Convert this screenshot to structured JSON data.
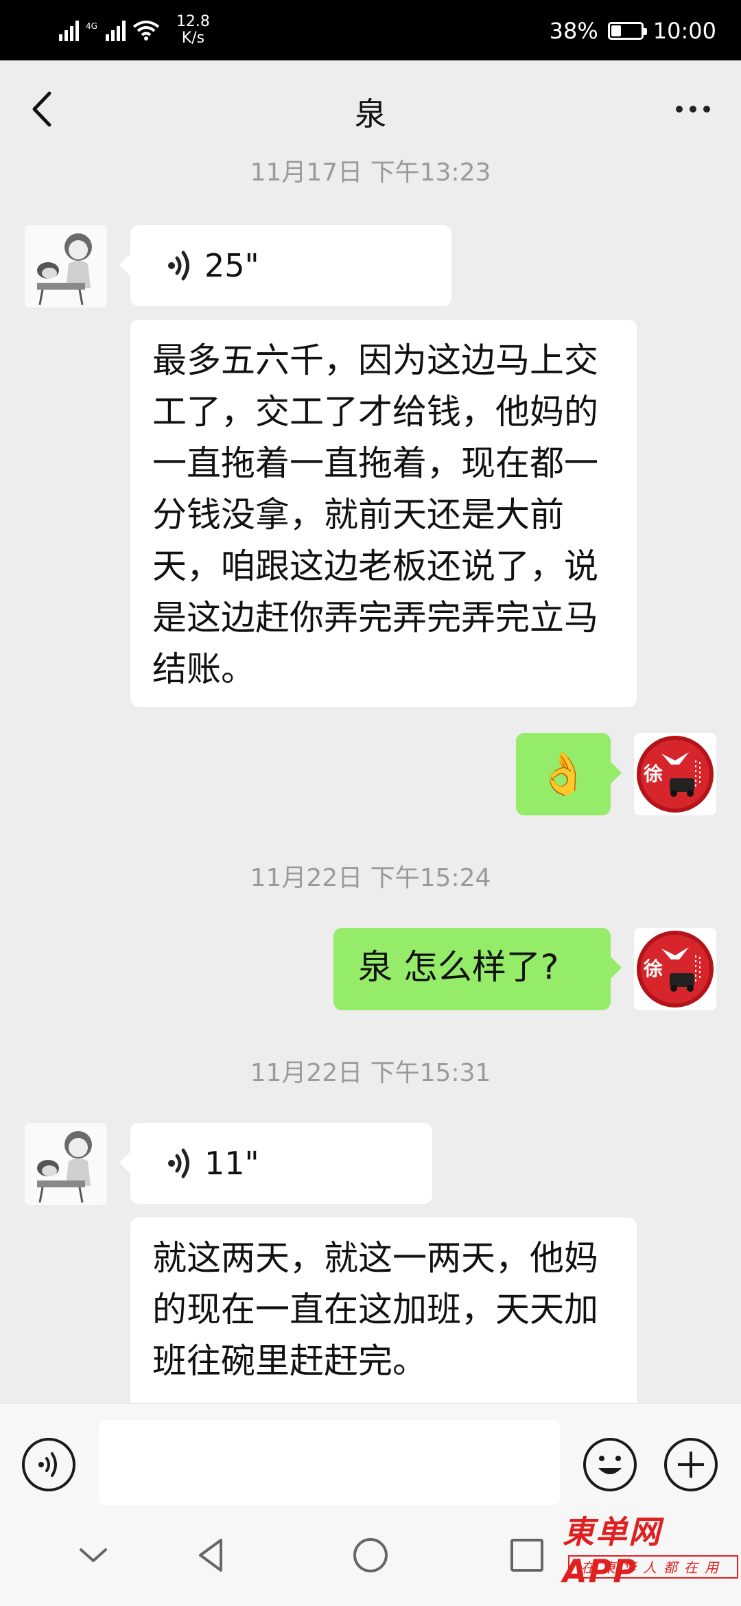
{
  "status_bar": {
    "network_label": "4G",
    "speed_value": "12.8",
    "speed_unit": "K/s",
    "battery": "38%",
    "time": "10:00"
  },
  "header": {
    "title": "泉"
  },
  "messages": [
    {
      "type": "timestamp",
      "text": "11月17日 下午13:23"
    },
    {
      "type": "voice",
      "side": "left",
      "duration": "25\""
    },
    {
      "type": "text",
      "side": "left",
      "text": "最多五六千，因为这边马上交工了，交工了才给钱，他妈的一直拖着一直拖着，现在都一分钱没拿，就前天还是大前天，咱跟这边老板还说了，说是这边赶你弄完弄完弄完立马结账。"
    },
    {
      "type": "emoji",
      "side": "right",
      "emoji": "👌"
    },
    {
      "type": "timestamp",
      "text": "11月22日 下午15:24"
    },
    {
      "type": "text",
      "side": "right",
      "text": "泉 怎么样了?"
    },
    {
      "type": "timestamp",
      "text": "11月22日 下午15:31"
    },
    {
      "type": "voice",
      "side": "left",
      "duration": "11\""
    },
    {
      "type": "text",
      "side": "left",
      "text": "就这两天，就这一两天，他妈的现在一直在这加班，天天加班往碗里赶赶完。"
    }
  ],
  "right_avatar_char": "徐",
  "watermark": {
    "main": "東单网",
    "app": "APP",
    "sub": "在東华人都在用"
  },
  "colors": {
    "right_bubble": "#95ec69",
    "left_bubble": "#ffffff",
    "background": "#ededed",
    "watermark": "#e02020"
  }
}
